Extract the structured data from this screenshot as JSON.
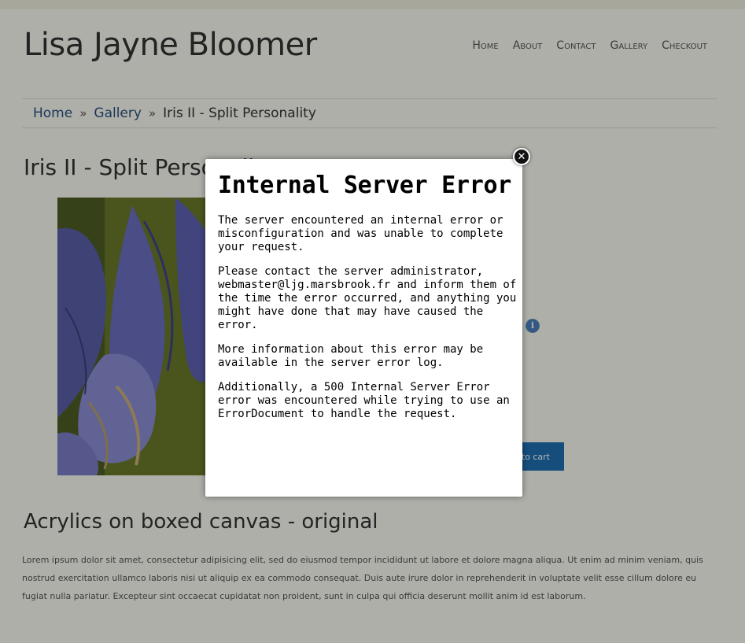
{
  "site": {
    "title": "Lisa Jayne Bloomer"
  },
  "nav": {
    "items": [
      "Home",
      "About",
      "Contact",
      "Gallery",
      "Checkout"
    ]
  },
  "breadcrumb": {
    "home": "Home",
    "gallery": "Gallery",
    "current": "Iris II - Split Personality",
    "separator": "»"
  },
  "product": {
    "title": "Iris II - Split Personality",
    "add_to_cart": "to cart",
    "subheading": "Acrylics on boxed canvas - original",
    "description": "Lorem ipsum dolor sit amet, consectetur adipisicing elit, sed do eiusmod tempor incididunt ut labore et dolore magna aliqua. Ut enim ad minim veniam, quis nostrud exercitation ullamco laboris nisi ut aliquip ex ea commodo consequat. Duis aute irure dolor in reprehenderit in voluptate velit esse cillum dolore eu fugiat nulla pariatur. Excepteur sint occaecat cupidatat non proident, sunt in culpa qui officia deserunt mollit anim id est laborum."
  },
  "modal": {
    "title": "Internal Server Error",
    "paragraphs": [
      "The server encountered an internal error or misconfiguration and was unable to complete your request.",
      "Please contact the server administrator, webmaster@ljg.marsbrook.fr and inform them of the time the error occurred, and anything you might have done that may have caused the error.",
      "More information about this error may be available in the server error log.",
      "Additionally, a 500 Internal Server Error error was encountered while trying to use an ErrorDocument to handle the request."
    ],
    "close_icon": "close-icon"
  },
  "colors": {
    "link": "#2a4f7f",
    "button": "#1f6fb2",
    "overlay": "rgba(0,0,0,0.3)"
  }
}
